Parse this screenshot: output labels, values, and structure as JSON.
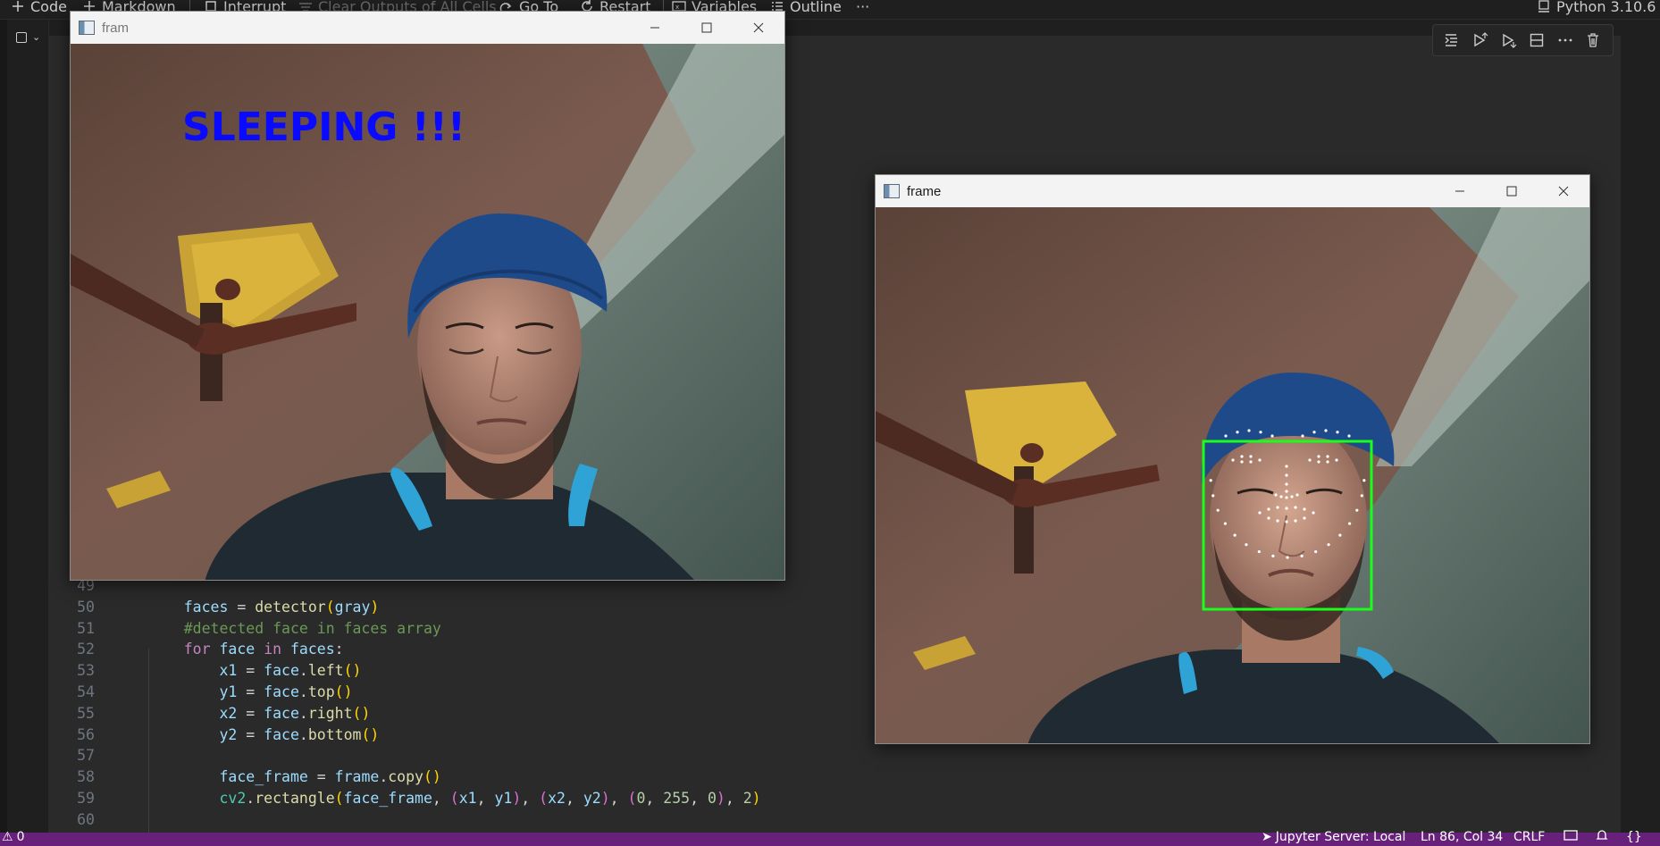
{
  "toolbar": {
    "code_label": "Code",
    "markdown_label": "Markdown",
    "interrupt_label": "Interrupt",
    "clear_outputs_label": "Clear Outputs of All Cells",
    "goto_label": "Go To",
    "restart_label": "Restart",
    "variables_label": "Variables",
    "outline_label": "Outline",
    "more_label": "···",
    "kernel_label": "Python 3.10.6"
  },
  "cell_actions": [
    "run-by-line-icon",
    "execute-above-icon",
    "execute-below-icon",
    "split-cell-icon",
    "more-actions-icon",
    "delete-cell-icon"
  ],
  "code": {
    "lines": [
      {
        "no": "49",
        "tokens": []
      },
      {
        "no": "50",
        "tokens": [
          [
            "    ",
            "pl"
          ],
          [
            "faces",
            "var"
          ],
          [
            " = ",
            "pl"
          ],
          [
            "detector",
            "fn"
          ],
          [
            "(",
            "p1"
          ],
          [
            "gray",
            "var"
          ],
          [
            ")",
            "p1"
          ]
        ]
      },
      {
        "no": "51",
        "tokens": [
          [
            "    ",
            "pl"
          ],
          [
            "#detected face in faces array",
            "cm"
          ]
        ]
      },
      {
        "no": "52",
        "tokens": [
          [
            "    ",
            "pl"
          ],
          [
            "for",
            "kw"
          ],
          [
            " ",
            "pl"
          ],
          [
            "face",
            "var"
          ],
          [
            " ",
            "pl"
          ],
          [
            "in",
            "kw"
          ],
          [
            " ",
            "pl"
          ],
          [
            "faces",
            "var"
          ],
          [
            ":",
            "pl"
          ]
        ]
      },
      {
        "no": "53",
        "tokens": [
          [
            "        ",
            "pl"
          ],
          [
            "x1",
            "var"
          ],
          [
            " = ",
            "pl"
          ],
          [
            "face",
            "var"
          ],
          [
            ".",
            "pl"
          ],
          [
            "left",
            "fn"
          ],
          [
            "()",
            "p1"
          ]
        ]
      },
      {
        "no": "54",
        "tokens": [
          [
            "        ",
            "pl"
          ],
          [
            "y1",
            "var"
          ],
          [
            " = ",
            "pl"
          ],
          [
            "face",
            "var"
          ],
          [
            ".",
            "pl"
          ],
          [
            "top",
            "fn"
          ],
          [
            "()",
            "p1"
          ]
        ]
      },
      {
        "no": "55",
        "tokens": [
          [
            "        ",
            "pl"
          ],
          [
            "x2",
            "var"
          ],
          [
            " = ",
            "pl"
          ],
          [
            "face",
            "var"
          ],
          [
            ".",
            "pl"
          ],
          [
            "right",
            "fn"
          ],
          [
            "()",
            "p1"
          ]
        ]
      },
      {
        "no": "56",
        "tokens": [
          [
            "        ",
            "pl"
          ],
          [
            "y2",
            "var"
          ],
          [
            " = ",
            "pl"
          ],
          [
            "face",
            "var"
          ],
          [
            ".",
            "pl"
          ],
          [
            "bottom",
            "fn"
          ],
          [
            "()",
            "p1"
          ]
        ]
      },
      {
        "no": "57",
        "tokens": []
      },
      {
        "no": "58",
        "tokens": [
          [
            "        ",
            "pl"
          ],
          [
            "face_frame",
            "var"
          ],
          [
            " = ",
            "pl"
          ],
          [
            "frame",
            "var"
          ],
          [
            ".",
            "pl"
          ],
          [
            "copy",
            "fn"
          ],
          [
            "()",
            "p1"
          ]
        ]
      },
      {
        "no": "59",
        "tokens": [
          [
            "        ",
            "pl"
          ],
          [
            "cv2",
            "mod"
          ],
          [
            ".",
            "pl"
          ],
          [
            "rectangle",
            "fn"
          ],
          [
            "(",
            "p1"
          ],
          [
            "face_frame",
            "var"
          ],
          [
            ", ",
            "pl"
          ],
          [
            "(",
            "p2"
          ],
          [
            "x1",
            "var"
          ],
          [
            ", ",
            "pl"
          ],
          [
            "y1",
            "var"
          ],
          [
            ")",
            "p2"
          ],
          [
            ", ",
            "pl"
          ],
          [
            "(",
            "p2"
          ],
          [
            "x2",
            "var"
          ],
          [
            ", ",
            "pl"
          ],
          [
            "y2",
            "var"
          ],
          [
            ")",
            "p2"
          ],
          [
            ", ",
            "pl"
          ],
          [
            "(",
            "p2"
          ],
          [
            "0",
            "num"
          ],
          [
            ", ",
            "pl"
          ],
          [
            "255",
            "num"
          ],
          [
            ", ",
            "pl"
          ],
          [
            "0",
            "num"
          ],
          [
            ")",
            "p2"
          ],
          [
            ", ",
            "pl"
          ],
          [
            "2",
            "num"
          ],
          [
            ")",
            "p1"
          ]
        ]
      },
      {
        "no": "60",
        "tokens": []
      }
    ]
  },
  "windows": {
    "left": {
      "title": "fram",
      "overlay_text": "SLEEPING !!!",
      "overlay_color": "#0a0aff"
    },
    "right": {
      "title": "frame",
      "box_color": "#1aff1a"
    }
  },
  "statusbar": {
    "problems": "0",
    "jupyter_server": "Jupyter Server: Local",
    "cursor_position": "Ln 86, Col 34",
    "line_ending": "CRLF",
    "notebook_icon": "notebook-icon",
    "bell_icon": "bell-icon",
    "braces_label": "{}"
  },
  "colors": {
    "statusbar": "#68217a",
    "editor_bg": "#1f1f1f"
  }
}
